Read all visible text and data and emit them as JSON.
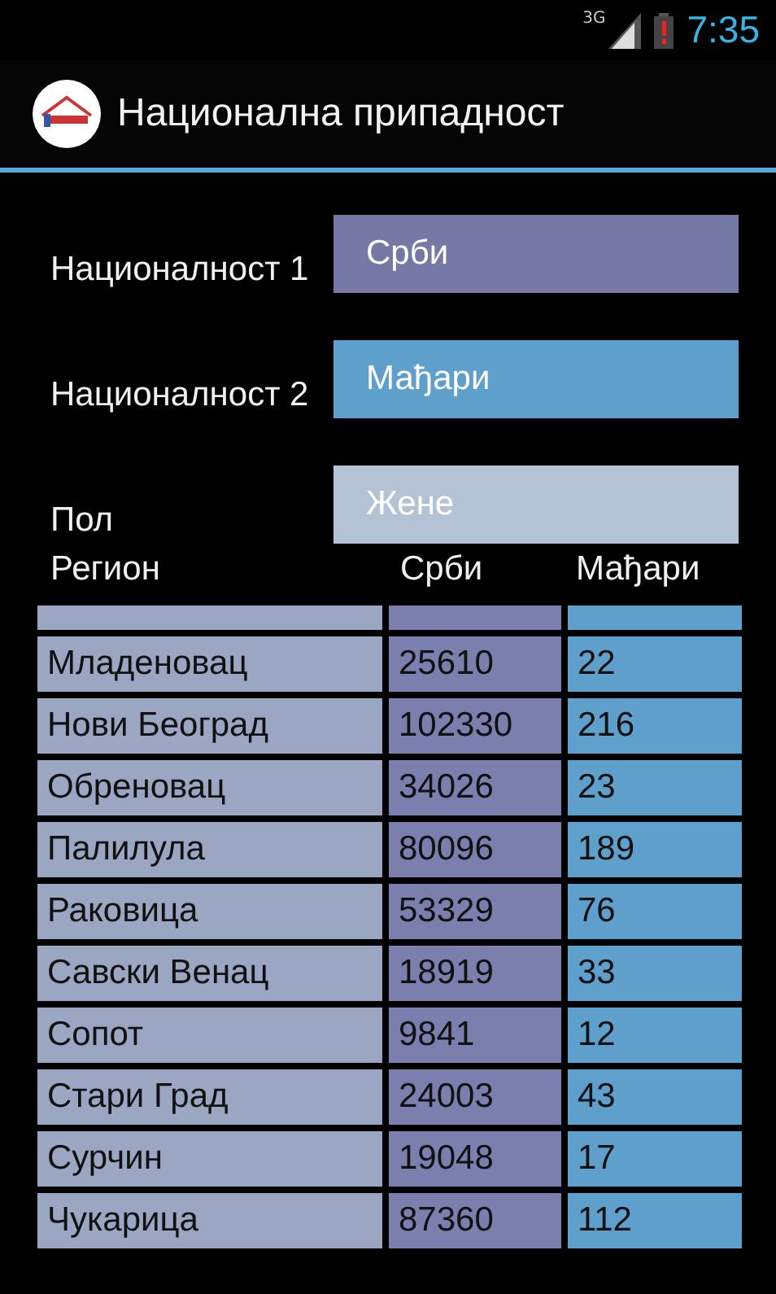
{
  "status_bar": {
    "network": "3G",
    "time": "7:35"
  },
  "action_bar": {
    "title": "Национална припадност"
  },
  "filters": [
    {
      "label": "Националност 1",
      "value": "Срби",
      "color": "#7679a6"
    },
    {
      "label": "Националност 2",
      "value": "Мађари",
      "color": "#5f9fcb"
    },
    {
      "label": "Пол",
      "value": "Жене",
      "color": "#b4c2d6"
    }
  ],
  "table": {
    "columns": [
      "Регион",
      "Срби",
      "Мађари"
    ],
    "rows": [
      [
        "Младеновац",
        "25610",
        "22"
      ],
      [
        "Нови Београд",
        "102330",
        "216"
      ],
      [
        "Обреновац",
        "34026",
        "23"
      ],
      [
        "Палилула",
        "80096",
        "189"
      ],
      [
        "Раковица",
        "53329",
        "76"
      ],
      [
        "Савски Венац",
        "18919",
        "33"
      ],
      [
        "Сопот",
        "9841",
        "12"
      ],
      [
        "Стари Град",
        "24003",
        "43"
      ],
      [
        "Сурчин",
        "19048",
        "17"
      ],
      [
        "Чукарица",
        "87360",
        "112"
      ]
    ]
  }
}
